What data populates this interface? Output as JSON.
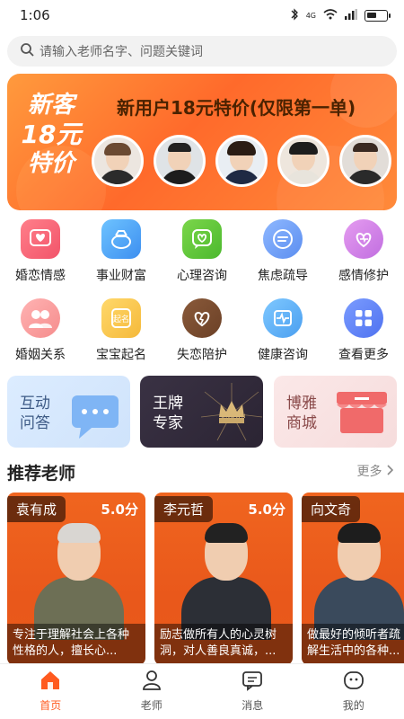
{
  "status_bar": {
    "time": "1:06",
    "network": "4G"
  },
  "search": {
    "placeholder": "请输入老师名字、问题关键词"
  },
  "banner": {
    "left_line1": "新客",
    "left_line2": "18元",
    "left_line3": "特价",
    "title": "新用户18元特价(仅限第一单)"
  },
  "categories": [
    {
      "label": "婚恋情感",
      "icon": "heart-message-icon"
    },
    {
      "label": "事业财富",
      "icon": "money-bag-icon"
    },
    {
      "label": "心理咨询",
      "icon": "heart-chat-icon"
    },
    {
      "label": "焦虑疏导",
      "icon": "chat-lines-icon"
    },
    {
      "label": "感情修护",
      "icon": "heart-repair-icon"
    },
    {
      "label": "婚姻关系",
      "icon": "couple-icon"
    },
    {
      "label": "宝宝起名",
      "icon": "naming-icon"
    },
    {
      "label": "失恋陪护",
      "icon": "broken-heart-icon"
    },
    {
      "label": "健康咨询",
      "icon": "pulse-icon"
    },
    {
      "label": "查看更多",
      "icon": "grid-more-icon"
    }
  ],
  "features": [
    {
      "line1": "互动",
      "line2": "问答"
    },
    {
      "line1": "王牌",
      "line2": "专家",
      "badge": "CROWN"
    },
    {
      "line1": "博雅",
      "line2": "商城"
    }
  ],
  "recommend": {
    "title": "推荐老师",
    "more_label": "更多",
    "teachers": [
      {
        "name": "袁有成",
        "score": "5.0分",
        "desc": "专注于理解社会上各种性格的人，擅长心..."
      },
      {
        "name": "李元哲",
        "score": "5.0分",
        "desc": "励志做所有人的心灵树洞，对人善良真诚，..."
      },
      {
        "name": "向文奇",
        "score": "",
        "desc": "做最好的倾听者疏解生活中的各种..."
      }
    ]
  },
  "tabbar": [
    {
      "label": "首页",
      "active": true
    },
    {
      "label": "老师",
      "active": false
    },
    {
      "label": "消息",
      "active": false
    },
    {
      "label": "我的",
      "active": false
    }
  ],
  "colors": {
    "accent": "#ff5a1f",
    "banner_start": "#ff9a3d",
    "banner_end": "#ff6a2b"
  }
}
